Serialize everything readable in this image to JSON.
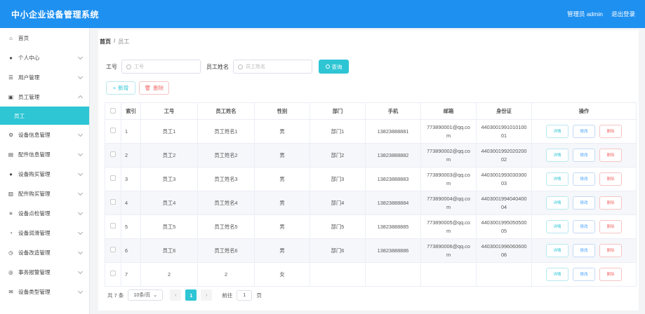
{
  "app": {
    "title": "中小企业设备管理系统",
    "user": "管理员 admin",
    "logout": "退出登录"
  },
  "sidebar": {
    "items": [
      {
        "label": "首页",
        "icon": "home-icon"
      },
      {
        "label": "个人中心",
        "icon": "user-icon"
      },
      {
        "label": "用户管理",
        "icon": "users-icon"
      },
      {
        "label": "员工管理",
        "icon": "id-card-icon"
      },
      {
        "label": "员工",
        "icon": ""
      },
      {
        "label": "设备信息管理",
        "icon": "settings-icon"
      },
      {
        "label": "配件信息管理",
        "icon": "box-icon"
      },
      {
        "label": "设备购买管理",
        "icon": "user-icon"
      },
      {
        "label": "配件购买管理",
        "icon": "print-icon"
      },
      {
        "label": "设备点检管理",
        "icon": "list-icon"
      },
      {
        "label": "设备润滑管理",
        "icon": "gauge-icon"
      },
      {
        "label": "设备改造管理",
        "icon": "clock-icon"
      },
      {
        "label": "事务报警管理",
        "icon": "bell-icon"
      },
      {
        "label": "设备类型管理",
        "icon": "mail-icon"
      }
    ]
  },
  "breadcrumb": {
    "home": "首页",
    "sep": "/",
    "current": "员工"
  },
  "search": {
    "id_label": "工号",
    "id_placeholder": "工号",
    "name_label": "员工姓名",
    "name_placeholder": "员工姓名",
    "query_label": "查询"
  },
  "actions": {
    "add": "新增",
    "delete": "删除"
  },
  "table": {
    "headers": [
      "",
      "索引",
      "工号",
      "员工姓名",
      "性别",
      "部门",
      "手机",
      "邮箱",
      "身份证",
      "操作"
    ],
    "rows": [
      {
        "index": "1",
        "id": "员工1",
        "name": "员工姓名1",
        "gender": "男",
        "dept": "部门1",
        "phone": "13823888881",
        "email1": "773890001@qq.co",
        "email2": "m",
        "idcard1": "4403001991010100",
        "idcard2": "01"
      },
      {
        "index": "2",
        "id": "员工2",
        "name": "员工姓名2",
        "gender": "男",
        "dept": "部门2",
        "phone": "13823888882",
        "email1": "773890002@qq.co",
        "email2": "m",
        "idcard1": "4403001992020200",
        "idcard2": "02"
      },
      {
        "index": "3",
        "id": "员工3",
        "name": "员工姓名3",
        "gender": "男",
        "dept": "部门3",
        "phone": "13823888883",
        "email1": "773890003@qq.co",
        "email2": "m",
        "idcard1": "4403001993030300",
        "idcard2": "03"
      },
      {
        "index": "4",
        "id": "员工4",
        "name": "员工姓名4",
        "gender": "男",
        "dept": "部门4",
        "phone": "13823888884",
        "email1": "773890004@qq.co",
        "email2": "m",
        "idcard1": "4403001994040400",
        "idcard2": "04"
      },
      {
        "index": "5",
        "id": "员工5",
        "name": "员工姓名5",
        "gender": "男",
        "dept": "部门5",
        "phone": "13823888885",
        "email1": "773890005@qq.co",
        "email2": "m",
        "idcard1": "4403001995050500",
        "idcard2": "05"
      },
      {
        "index": "6",
        "id": "员工6",
        "name": "员工姓名6",
        "gender": "男",
        "dept": "部门6",
        "phone": "13823888886",
        "email1": "773890006@qq.co",
        "email2": "m",
        "idcard1": "4403001996060600",
        "idcard2": "06"
      },
      {
        "index": "7",
        "id": "2",
        "name": "2",
        "gender": "女",
        "dept": "",
        "phone": "",
        "email1": "",
        "email2": "",
        "idcard1": "",
        "idcard2": ""
      }
    ],
    "op_detail": "详情",
    "op_edit": "修改",
    "op_delete": "删除"
  },
  "pager": {
    "total": "共 7 条",
    "size": "10条/页",
    "page": "1",
    "goto": "前往",
    "goto_value": "1",
    "unit": "页"
  },
  "colors": {
    "topbar": "#1e90f0",
    "accent": "#2ec5d4",
    "danger": "#f56c6c"
  }
}
